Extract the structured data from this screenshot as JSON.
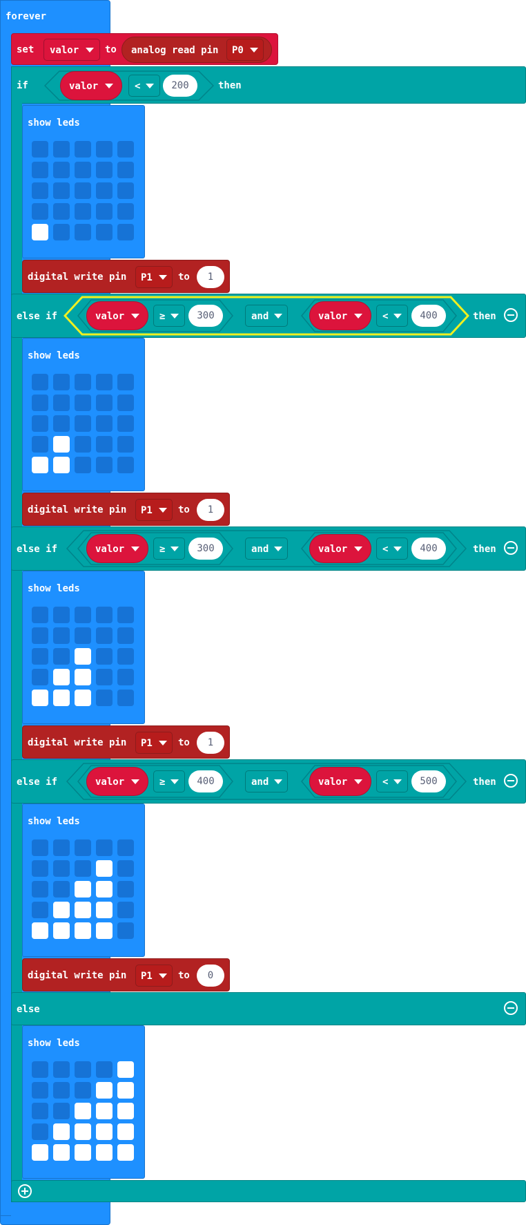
{
  "forever_label": "forever",
  "set_block": {
    "set": "set",
    "variable": "valor",
    "to": "to",
    "reporter": "analog read pin",
    "pin": "P0"
  },
  "if_label": "if",
  "then_label": "then",
  "else_if_label": "else if",
  "else_label": "else",
  "and_label": "and",
  "show_leds_label": "show leds",
  "digital_write_label": "digital write pin",
  "to_label": "to",
  "first_condition": {
    "variable": "valor",
    "op": "<",
    "value": "200"
  },
  "branches": [
    {
      "kind": "if",
      "leds": [
        [
          0,
          0,
          0,
          0,
          0
        ],
        [
          0,
          0,
          0,
          0,
          0
        ],
        [
          0,
          0,
          0,
          0,
          0
        ],
        [
          0,
          0,
          0,
          0,
          0
        ],
        [
          1,
          0,
          0,
          0,
          0
        ]
      ],
      "pin": "P1",
      "write": "1"
    },
    {
      "kind": "else if",
      "left": {
        "variable": "valor",
        "op": "≥",
        "value": "300"
      },
      "right": {
        "variable": "valor",
        "op": "<",
        "value": "400"
      },
      "leds": [
        [
          0,
          0,
          0,
          0,
          0
        ],
        [
          0,
          0,
          0,
          0,
          0
        ],
        [
          0,
          0,
          0,
          0,
          0
        ],
        [
          0,
          1,
          0,
          0,
          0
        ],
        [
          1,
          1,
          0,
          0,
          0
        ]
      ],
      "pin": "P1",
      "write": "1"
    },
    {
      "kind": "else if",
      "left": {
        "variable": "valor",
        "op": "≥",
        "value": "300"
      },
      "right": {
        "variable": "valor",
        "op": "<",
        "value": "400"
      },
      "leds": [
        [
          0,
          0,
          0,
          0,
          0
        ],
        [
          0,
          0,
          0,
          0,
          0
        ],
        [
          0,
          0,
          1,
          0,
          0
        ],
        [
          0,
          1,
          1,
          0,
          0
        ],
        [
          1,
          1,
          1,
          0,
          0
        ]
      ],
      "pin": "P1",
      "write": "1"
    },
    {
      "kind": "else if",
      "left": {
        "variable": "valor",
        "op": "≥",
        "value": "400"
      },
      "right": {
        "variable": "valor",
        "op": "<",
        "value": "500"
      },
      "leds": [
        [
          0,
          0,
          0,
          0,
          0
        ],
        [
          0,
          0,
          0,
          1,
          0
        ],
        [
          0,
          0,
          1,
          1,
          0
        ],
        [
          0,
          1,
          1,
          1,
          0
        ],
        [
          1,
          1,
          1,
          1,
          0
        ]
      ],
      "pin": "P1",
      "write": "0"
    },
    {
      "kind": "else",
      "leds": [
        [
          0,
          0,
          0,
          0,
          1
        ],
        [
          0,
          0,
          0,
          1,
          1
        ],
        [
          0,
          0,
          1,
          1,
          1
        ],
        [
          0,
          1,
          1,
          1,
          1
        ],
        [
          1,
          1,
          1,
          1,
          1
        ]
      ]
    }
  ],
  "icons": {
    "dropdown": "caret-down-icon",
    "remove": "minus-circle-icon",
    "add": "plus-circle-icon"
  },
  "colors": {
    "basic": "#1e90ff",
    "logic": "#00a4a6",
    "variables": "#dc143c",
    "pins": "#b22222",
    "highlight": "#f0f020"
  }
}
